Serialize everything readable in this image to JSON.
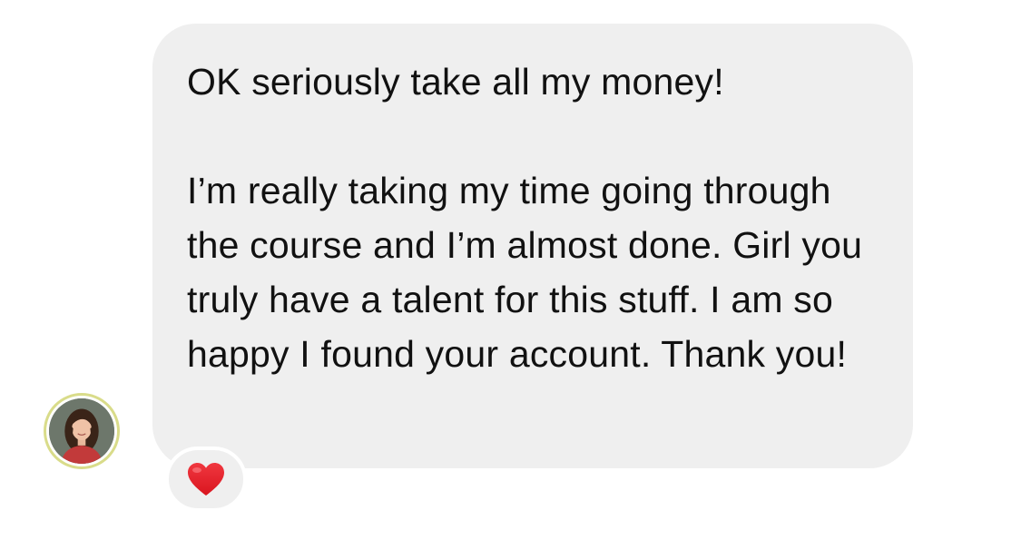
{
  "message": {
    "paragraph_1": "OK seriously take all my money!",
    "paragraph_2": "I’m really taking my time going through the course and I’m almost done. Girl you truly have a talent for this stuff. I am so happy I found your account. Thank you!"
  },
  "reaction": {
    "icon": "heart-icon",
    "color": "#e8202b"
  },
  "colors": {
    "bubble_background": "#efefef",
    "text": "#111111",
    "avatar_ring": "#d9dc8a"
  }
}
